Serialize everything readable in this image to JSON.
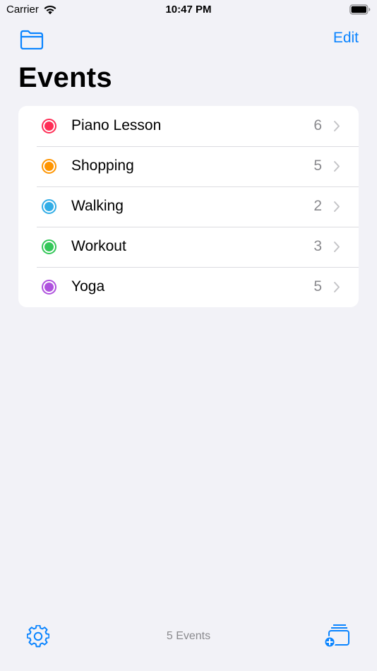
{
  "status_bar": {
    "carrier": "Carrier",
    "time": "10:47 PM"
  },
  "nav": {
    "edit_label": "Edit"
  },
  "title": "Events",
  "events": [
    {
      "label": "Piano Lesson",
      "count": "6",
      "color": "#ff2d55"
    },
    {
      "label": "Shopping",
      "count": "5",
      "color": "#ff9500"
    },
    {
      "label": "Walking",
      "count": "2",
      "color": "#32ade6"
    },
    {
      "label": "Workout",
      "count": "3",
      "color": "#34c759"
    },
    {
      "label": "Yoga",
      "count": "5",
      "color": "#af52de"
    }
  ],
  "toolbar": {
    "count_label": "5 Events"
  },
  "icons": {
    "folder": "folder-icon",
    "gear": "gear-icon",
    "new_list": "add-list-icon",
    "chevron": "chevron-right-icon"
  },
  "colors": {
    "accent": "#0a84ff",
    "background": "#f2f2f7",
    "secondary_text": "#8a8a8e"
  }
}
